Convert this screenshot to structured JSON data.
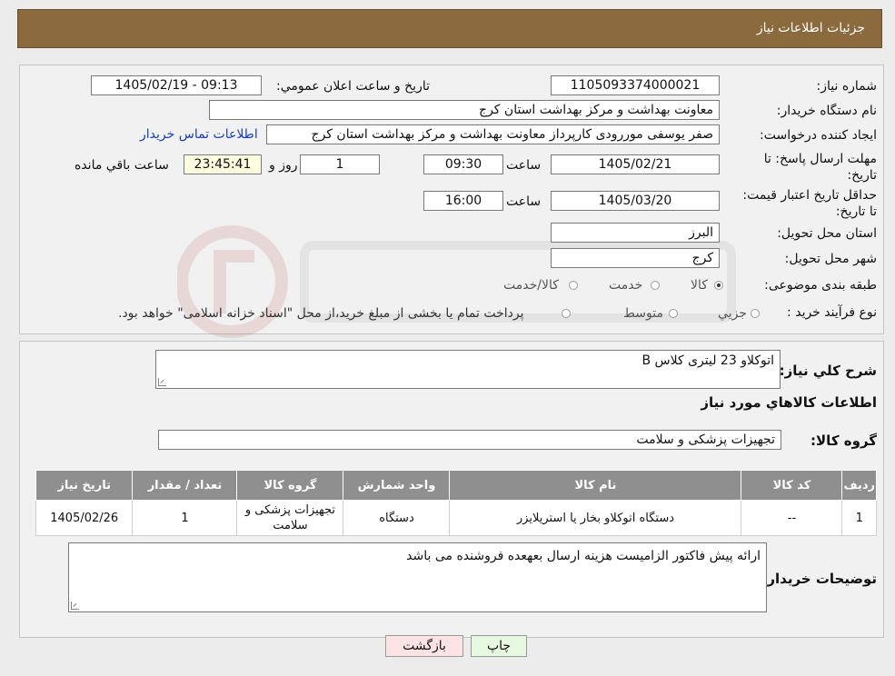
{
  "header": {
    "title": "جزئیات اطلاعات نیاز"
  },
  "form": {
    "need_number_label": "شماره نیاز:",
    "need_number": "1105093374000021",
    "announce_label": "تاریخ و ساعت اعلان عمومي:",
    "announce_value": "1405/02/19 - 09:13",
    "buyer_org_label": "نام دستگاه خریدار:",
    "buyer_org": "معاونت بهداشت و مرکز بهداشت استان کرج",
    "creator_label": "ایجاد کننده درخواست:",
    "creator": "صفر یوسفی موررودی کارپرداز معاونت بهداشت و مرکز بهداشت استان کرج",
    "contact_link": "اطلاعات تماس خریدار",
    "deadline_label": "مهلت ارسال پاسخ: تا تاریخ:",
    "deadline_date": "1405/02/21",
    "time_label": "ساعت",
    "deadline_time": "09:30",
    "days_value": "1",
    "days_label": "روز و",
    "remaining_time": "23:45:41",
    "remaining_label": "ساعت باقي مانده",
    "validity_label": "حداقل تاریخ اعتبار قیمت: تا تاریخ:",
    "validity_date": "1405/03/20",
    "validity_time": "16:00",
    "province_label": "استان محل تحویل:",
    "province": "البرز",
    "city_label": "شهر محل تحویل:",
    "city": "کرج",
    "category_label": "طبقه بندی موضوعی:",
    "category_options": [
      "کالا",
      "خدمت",
      "کالا/خدمت"
    ],
    "category_selected": 0,
    "process_label": "نوع فرآیند خرید :",
    "process_options": [
      "جزیي",
      "متوسط"
    ],
    "process_note": "پرداخت تمام یا بخشی از مبلغ خرید،از محل \"اسناد خزانه اسلامی\" خواهد بود."
  },
  "summary": {
    "desc_label": "شرح کلي نیاز:",
    "desc_value": "اتوکلاو 23 لیتری کلاس B",
    "goods_info_title": "اطلاعات کالاهاي مورد نیاز",
    "goods_group_label": "گروه کالا:",
    "goods_group_value": "تجهیزات پزشکی و سلامت"
  },
  "table": {
    "headers": [
      "ردیف",
      "کد کالا",
      "نام کالا",
      "واحد شمارش",
      "گروه کالا",
      "تعداد / مقدار",
      "تاریخ نیاز"
    ],
    "row": [
      "1",
      "--",
      "دستگاه اتوکلاو بخار یا استریلایزر",
      "دستگاه",
      "تجهیزات پزشکی و سلامت",
      "1",
      "1405/02/26"
    ]
  },
  "buyer_notes": {
    "label": "توضیحات خریدار:",
    "value": "ارائه پیش فاکتور الزامیست هزینه ارسال بعهعده فروشنده می باشد"
  },
  "buttons": {
    "print": "چاپ",
    "back": "بازگشت"
  },
  "colors": {
    "header_bg": "#8b6a3e",
    "back_button_bg": "#fde3e3",
    "print_button_bg": "#e6f8e0"
  }
}
